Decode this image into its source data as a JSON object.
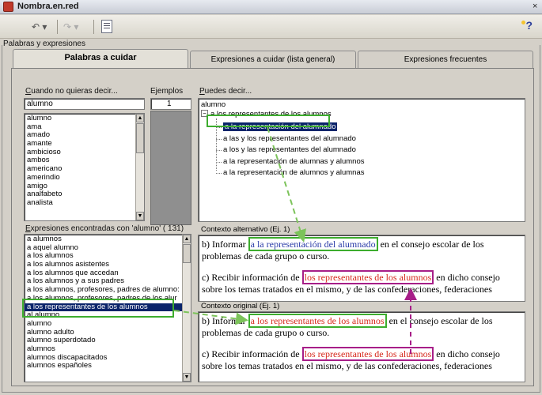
{
  "window": {
    "title": "Nombra.en.red",
    "close_glyph": "×"
  },
  "toolbar": {
    "undo": "↶ ▾",
    "redo": "↷ ▾",
    "help": "?"
  },
  "group_label": "Palabras y expresiones",
  "tabs": [
    {
      "label": "Palabras a cuidar",
      "active": true
    },
    {
      "label": "Expresiones a cuidar (lista general)",
      "active": false
    },
    {
      "label": "Expresiones frecuentes",
      "active": false
    }
  ],
  "left": {
    "search_label_first": "C",
    "search_label_rest": "uando no quieras decir...",
    "search_value": "alumno",
    "word_list": [
      "alumno",
      "ama",
      "amado",
      "amante",
      "ambicioso",
      "ambos",
      "americano",
      "amerindio",
      "amigo",
      "analfabeto",
      "analista"
    ],
    "found_label_first": "E",
    "found_label_rest": "xpresiones encontradas con 'alumno' ( 131)",
    "found_list": [
      "a alumnos",
      "a aquel alumno",
      "a los alumnos",
      "a los alumnos asistentes",
      "a los alumnos que accedan",
      "a los alumnos y a sus padres",
      "a los alumnos, profesores, padres de alumno:",
      "a los alumnos, profesores, padres de los alur",
      "a los representantes de los alumnos",
      "al alumno",
      "alumno",
      "alumno adulto",
      "alumno superdotado",
      "alumnos",
      "alumnos discapacitados",
      "alumnos españoles"
    ],
    "found_selected_index": 8
  },
  "examples": {
    "label": "Ejemplos",
    "value": "1"
  },
  "right": {
    "suggest_label_first": "P",
    "suggest_label_rest": "uedes decir...",
    "tree_root": "alumno",
    "tree_parent": "a los representantes de los alumnos",
    "tree_children": [
      "a la representación del alumnado",
      "a las y los representantes del alumnado",
      "a los y las representantes del alumnado",
      "a la representación de alumnas y alumnos",
      "a la representación de alumnos y alumnas"
    ],
    "tree_selected_index": 0,
    "alt_context_label": "Contexto alternativo (Ej. 1)",
    "alt_context": {
      "b_prefix": "b) Informar ",
      "b_highlight": "a la representación del alumnado",
      "b_suffix": " en el consejo escolar de los problemas de cada grupo o curso.",
      "c_prefix": "c) Recibir información de ",
      "c_highlight": "los representantes de los alumnos",
      "c_suffix": " en dicho consejo sobre los temas tratados en el mismo, y de las confederaciones, federaciones"
    },
    "orig_context_label": "Contexto original (Ej. 1)",
    "orig_context": {
      "b_prefix": "b) Informar ",
      "b_highlight": "a los representantes de los alumnos",
      "b_suffix": " en el consejo escolar de los problemas de cada grupo o curso.",
      "c_prefix": "c) Recibir información de ",
      "c_highlight": "los representantes de los alumnos",
      "c_suffix": " en dicho consejo sobre los temas tratados en el mismo, y de las confederaciones, federaciones"
    }
  },
  "colors": {
    "green_highlight": "#3dad2e",
    "magenta_highlight": "#a71e88",
    "selection": "#0a246a"
  }
}
